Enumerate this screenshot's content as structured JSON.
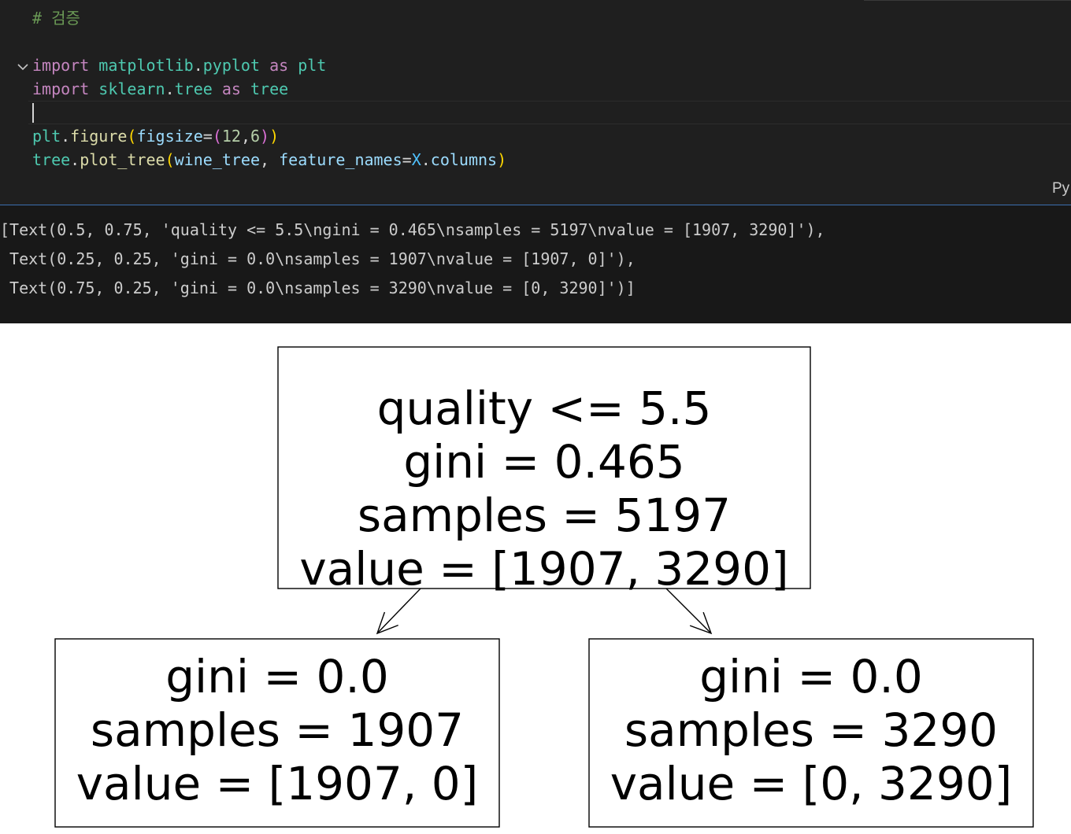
{
  "editor": {
    "lines": [
      {
        "tokens": [
          {
            "t": "# 검증",
            "c": "cm"
          }
        ]
      },
      {
        "tokens": []
      },
      {
        "tokens": [
          {
            "t": "import",
            "c": "kw"
          },
          {
            "t": " "
          },
          {
            "t": "matplotlib",
            "c": "mod"
          },
          {
            "t": "."
          },
          {
            "t": "pyplot",
            "c": "mod"
          },
          {
            "t": " "
          },
          {
            "t": "as",
            "c": "kw"
          },
          {
            "t": " "
          },
          {
            "t": "plt",
            "c": "mod"
          }
        ]
      },
      {
        "tokens": [
          {
            "t": "import",
            "c": "kw"
          },
          {
            "t": " "
          },
          {
            "t": "sklearn",
            "c": "mod"
          },
          {
            "t": "."
          },
          {
            "t": "tree",
            "c": "mod"
          },
          {
            "t": " "
          },
          {
            "t": "as",
            "c": "kw"
          },
          {
            "t": " "
          },
          {
            "t": "tree",
            "c": "mod"
          }
        ]
      },
      {
        "tokens": []
      },
      {
        "tokens": [
          {
            "t": "plt",
            "c": "mod"
          },
          {
            "t": "."
          },
          {
            "t": "figure",
            "c": "fn"
          },
          {
            "t": "(",
            "c": "br1"
          },
          {
            "t": "figsize",
            "c": "var"
          },
          {
            "t": "="
          },
          {
            "t": "(",
            "c": "br2"
          },
          {
            "t": "12",
            "c": "num"
          },
          {
            "t": ","
          },
          {
            "t": "6",
            "c": "num"
          },
          {
            "t": ")",
            "c": "br2"
          },
          {
            "t": ")",
            "c": "br1"
          }
        ]
      },
      {
        "tokens": [
          {
            "t": "tree",
            "c": "mod"
          },
          {
            "t": "."
          },
          {
            "t": "plot_tree",
            "c": "fn"
          },
          {
            "t": "(",
            "c": "br1"
          },
          {
            "t": "wine_tree",
            "c": "var"
          },
          {
            "t": ", "
          },
          {
            "t": "feature_names",
            "c": "var"
          },
          {
            "t": "="
          },
          {
            "t": "X",
            "c": "ct"
          },
          {
            "t": "."
          },
          {
            "t": "columns",
            "c": "var"
          },
          {
            "t": ")",
            "c": "br1"
          }
        ]
      }
    ],
    "language_badge": "Py"
  },
  "output": {
    "lines": [
      "[Text(0.5, 0.75, 'quality <= 5.5\\ngini = 0.465\\nsamples = 5197\\nvalue = [1907, 3290]'),",
      " Text(0.25, 0.25, 'gini = 0.0\\nsamples = 1907\\nvalue = [1907, 0]'),",
      " Text(0.75, 0.25, 'gini = 0.0\\nsamples = 3290\\nvalue = [0, 3290]')]"
    ]
  },
  "chart_data": {
    "type": "tree",
    "nodes": [
      {
        "id": "root",
        "lines": [
          "quality <= 5.5",
          "gini = 0.465",
          "samples = 5197",
          "value = [1907, 3290]"
        ]
      },
      {
        "id": "left",
        "lines": [
          "gini = 0.0",
          "samples = 1907",
          "value = [1907, 0]"
        ]
      },
      {
        "id": "right",
        "lines": [
          "gini = 0.0",
          "samples = 3290",
          "value = [0, 3290]"
        ]
      }
    ],
    "edges": [
      {
        "from": "root",
        "to": "left"
      },
      {
        "from": "root",
        "to": "right"
      }
    ]
  }
}
